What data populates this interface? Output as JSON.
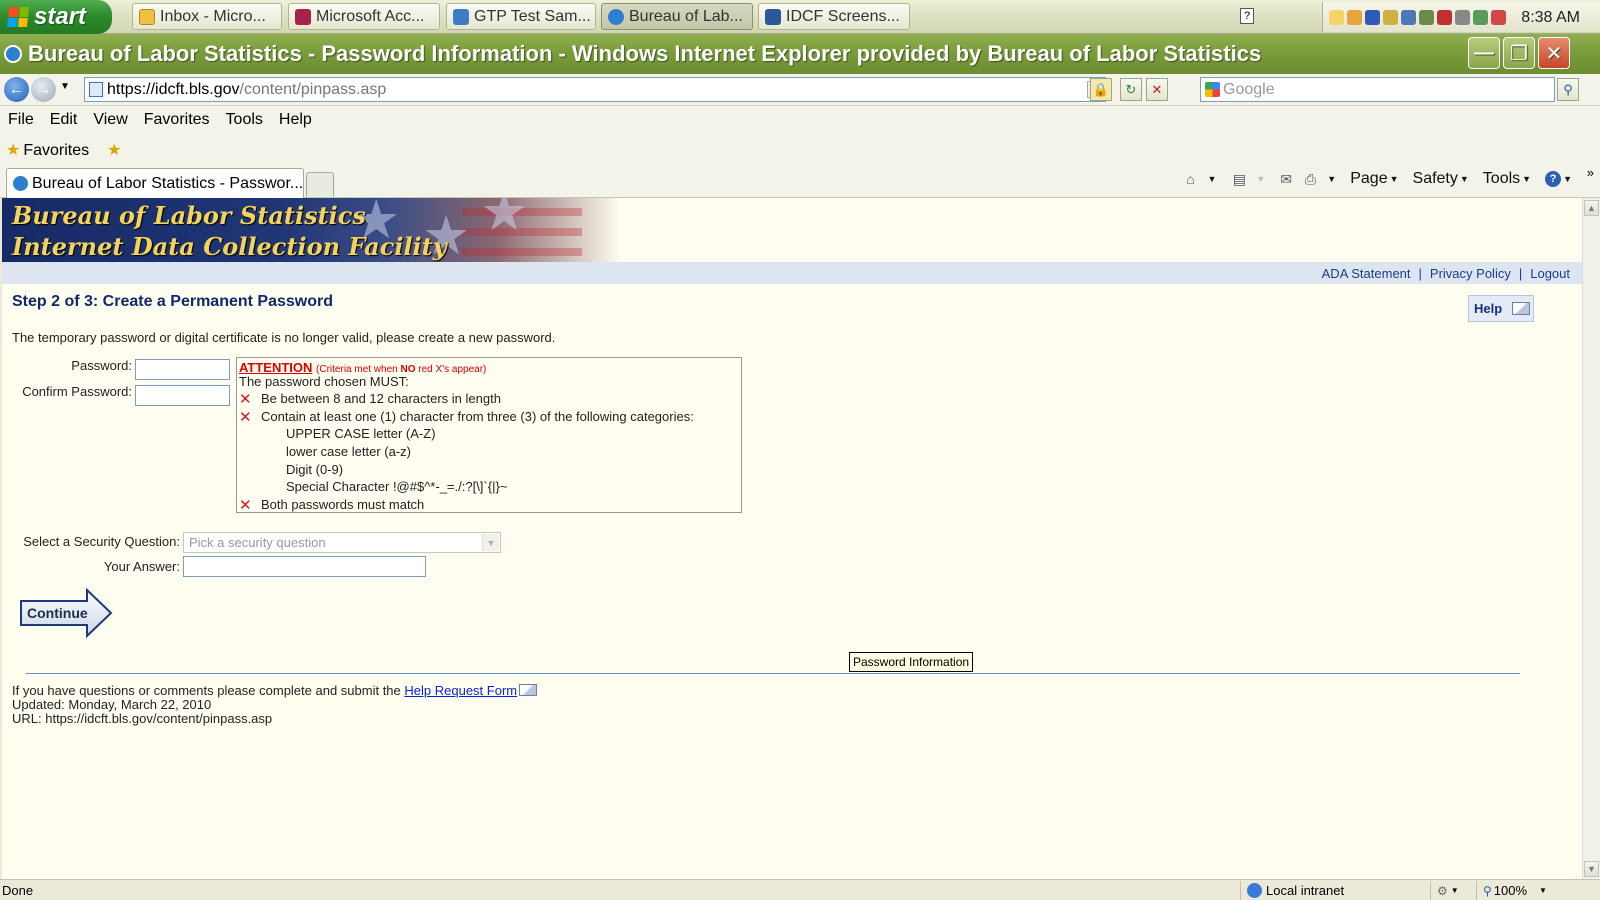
{
  "taskbar": {
    "start_label": "start",
    "tasks": [
      {
        "label": "Inbox - Micro..."
      },
      {
        "label": "Microsoft Acc..."
      },
      {
        "label": "GTP Test Sam..."
      },
      {
        "label": "Bureau of Lab..."
      },
      {
        "label": "IDCF Screens..."
      }
    ],
    "clock": "8:38 AM"
  },
  "window": {
    "title": "Bureau of Labor Statistics - Password Information - Windows Internet Explorer provided by Bureau of Labor Statistics"
  },
  "address": {
    "url_host": "https://idcft.bls.gov",
    "url_path": "/content/pinpass.asp",
    "search_placeholder": "Google"
  },
  "menu": {
    "items": [
      "File",
      "Edit",
      "View",
      "Favorites",
      "Tools",
      "Help"
    ]
  },
  "favorites": {
    "label": "Favorites"
  },
  "tab": {
    "title": "Bureau of Labor Statistics - Passwor..."
  },
  "command_bar": {
    "page": "Page",
    "safety": "Safety",
    "tools": "Tools"
  },
  "banner": {
    "line1": "Bureau of Labor Statistics",
    "line2": "Internet Data Collection Facility"
  },
  "top_links": {
    "ada": "ADA Statement",
    "privacy": "Privacy Policy",
    "logout": "Logout"
  },
  "page": {
    "step_title": "Step 2 of 3: Create a Permanent Password",
    "help_label": "Help",
    "intro": "The temporary password or digital certificate is no longer valid, please create a new password.",
    "password_label": "Password:",
    "password_value": "",
    "confirm_label": "Confirm Password:",
    "confirm_value": "",
    "criteria": {
      "attention": "ATTENTION",
      "note_prefix": "(Criteria met when ",
      "note_bold": "NO",
      "note_suffix": " red X's appear)",
      "must": "The password chosen MUST:",
      "rule_length": "Be between 8 and 12 characters in length",
      "rule_categories": "Contain at least one (1) character from three (3) of the following categories:",
      "cat_upper": "UPPER CASE letter (A-Z)",
      "cat_lower": "lower case letter (a-z)",
      "cat_digit": "Digit (0-9)",
      "cat_special": "Special Character !@#$^*-_=./:?[\\]`{|}~",
      "rule_match": "Both passwords must match"
    },
    "security_question_label": "Select a Security Question:",
    "security_question_placeholder": "Pick a security question",
    "answer_label": "Your Answer:",
    "answer_value": "",
    "continue_label": "Continue",
    "tooltip": "Password Information"
  },
  "footer": {
    "questions_prefix": "If you have questions or comments please complete and submit the ",
    "help_link": "Help Request Form",
    "updated": "Updated: Monday, March 22, 2010",
    "url": "URL: https://idcft.bls.gov/content/pinpass.asp"
  },
  "statusbar": {
    "status": "Done",
    "zone": "Local intranet",
    "zoom": "100%"
  },
  "colors": {
    "title_bar": "#7a9c3b",
    "page_bg": "#fffef0",
    "heading": "#0f2a6a",
    "error_x": "#e0141c"
  }
}
